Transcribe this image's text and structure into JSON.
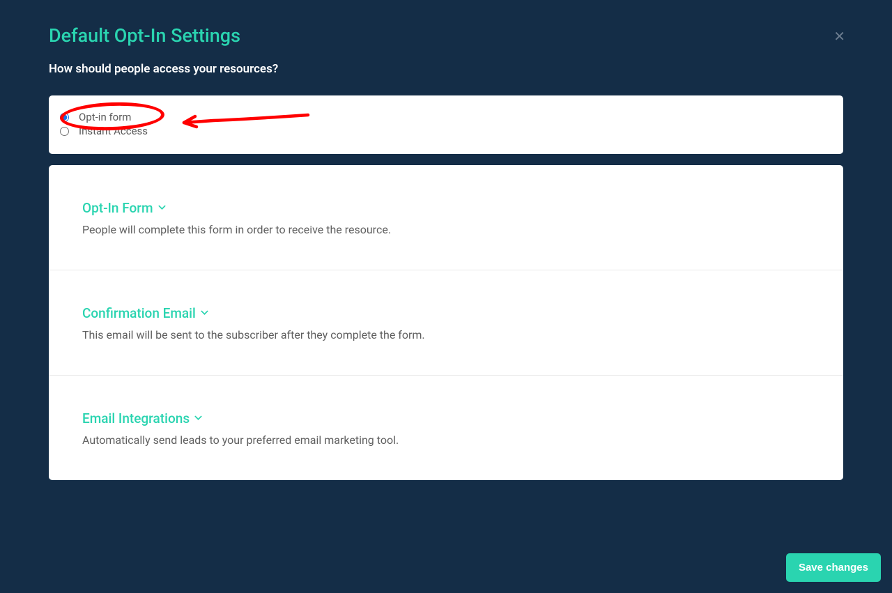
{
  "modal": {
    "title": "Default Opt-In Settings",
    "subtitle": "How should people access your resources?"
  },
  "radios": {
    "optIn": "Opt-in form",
    "instant": "Instant Access"
  },
  "sections": [
    {
      "title": "Opt-In Form",
      "desc": "People will complete this form in order to receive the resource."
    },
    {
      "title": "Confirmation Email",
      "desc": "This email will be sent to the subscriber after they complete the form."
    },
    {
      "title": "Email Integrations",
      "desc": "Automatically send leads to your preferred email marketing tool."
    }
  ],
  "buttons": {
    "save": "Save changes"
  }
}
